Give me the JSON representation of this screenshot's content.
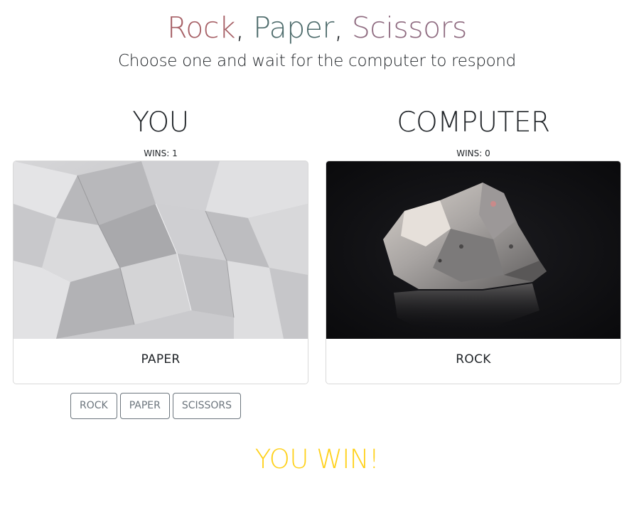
{
  "header": {
    "title_rock": "Rock",
    "title_sep1": ", ",
    "title_paper": "Paper",
    "title_sep2": ", ",
    "title_scissors": "Scissors",
    "subtitle": "Choose one and wait for the computer to respond"
  },
  "colors": {
    "rock": "#a65f65",
    "paper": "#4d6b6b",
    "scissors": "#8f6b80",
    "result": "#ffd11a",
    "button_border": "#6c757d"
  },
  "player": {
    "name": "YOU",
    "wins_label": "WINS: 1",
    "choice_label": "PAPER",
    "choice_image": "crumpled-paper-image"
  },
  "computer": {
    "name": "COMPUTER",
    "wins_label": "WINS: 0",
    "choice_label": "ROCK",
    "choice_image": "rock-image"
  },
  "buttons": {
    "rock": "ROCK",
    "paper": "PAPER",
    "scissors": "SCISSORS"
  },
  "result": "YOU WIN!"
}
